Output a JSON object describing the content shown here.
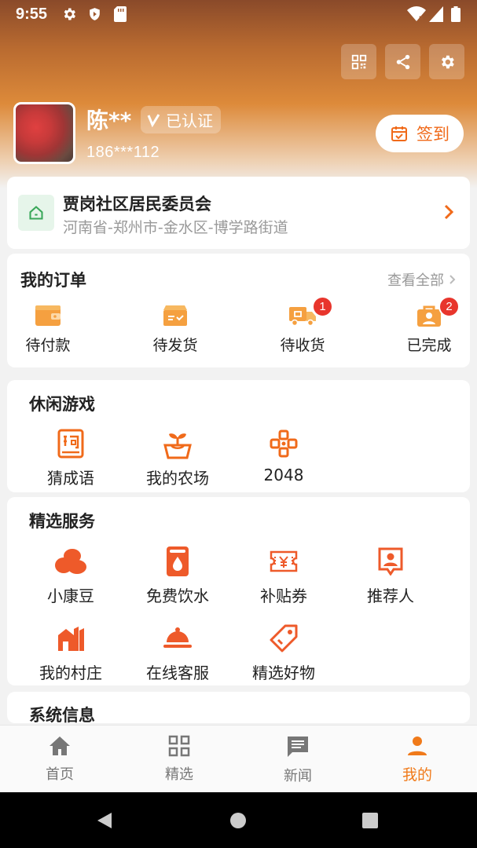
{
  "status_bar": {
    "time": "9:55"
  },
  "profile": {
    "name": "陈**",
    "verified_label": "已认证",
    "phone": "186***112",
    "checkin_label": "签到"
  },
  "community": {
    "name": "贾岗社区居民委员会",
    "address": "河南省-郑州市-金水区-博学路街道"
  },
  "orders": {
    "title": "我的订单",
    "view_all": "查看全部",
    "items": [
      {
        "label": "待付款",
        "icon": "wallet-icon"
      },
      {
        "label": "待发货",
        "icon": "package-icon"
      },
      {
        "label": "待收货",
        "icon": "truck-icon",
        "badge": "1"
      },
      {
        "label": "已完成",
        "icon": "completed-icon",
        "badge": "2"
      }
    ]
  },
  "games": {
    "title": "休闲游戏",
    "items": [
      {
        "label": "猜成语",
        "icon": "idiom-book-icon"
      },
      {
        "label": "我的农场",
        "icon": "farm-sprout-icon"
      },
      {
        "label": "2048",
        "icon": "gamepad-icon"
      }
    ]
  },
  "services": {
    "title": "精选服务",
    "items": [
      {
        "label": "小康豆",
        "icon": "beans-icon"
      },
      {
        "label": "免费饮水",
        "icon": "water-dispenser-icon"
      },
      {
        "label": "补贴券",
        "icon": "coupon-icon"
      },
      {
        "label": "推荐人",
        "icon": "referrer-icon"
      },
      {
        "label": "我的村庄",
        "icon": "village-icon"
      },
      {
        "label": "在线客服",
        "icon": "customer-service-icon"
      },
      {
        "label": "精选好物",
        "icon": "tag-icon"
      }
    ]
  },
  "system_info": {
    "title": "系统信息"
  },
  "tabbar": {
    "items": [
      {
        "label": "首页",
        "icon": "home-icon"
      },
      {
        "label": "精选",
        "icon": "grid-icon"
      },
      {
        "label": "新闻",
        "icon": "news-icon"
      },
      {
        "label": "我的",
        "icon": "user-icon",
        "active": true
      }
    ]
  },
  "colors": {
    "accent": "#f06a1a",
    "badge": "#e8352c",
    "tab_active": "#f07a1a"
  }
}
